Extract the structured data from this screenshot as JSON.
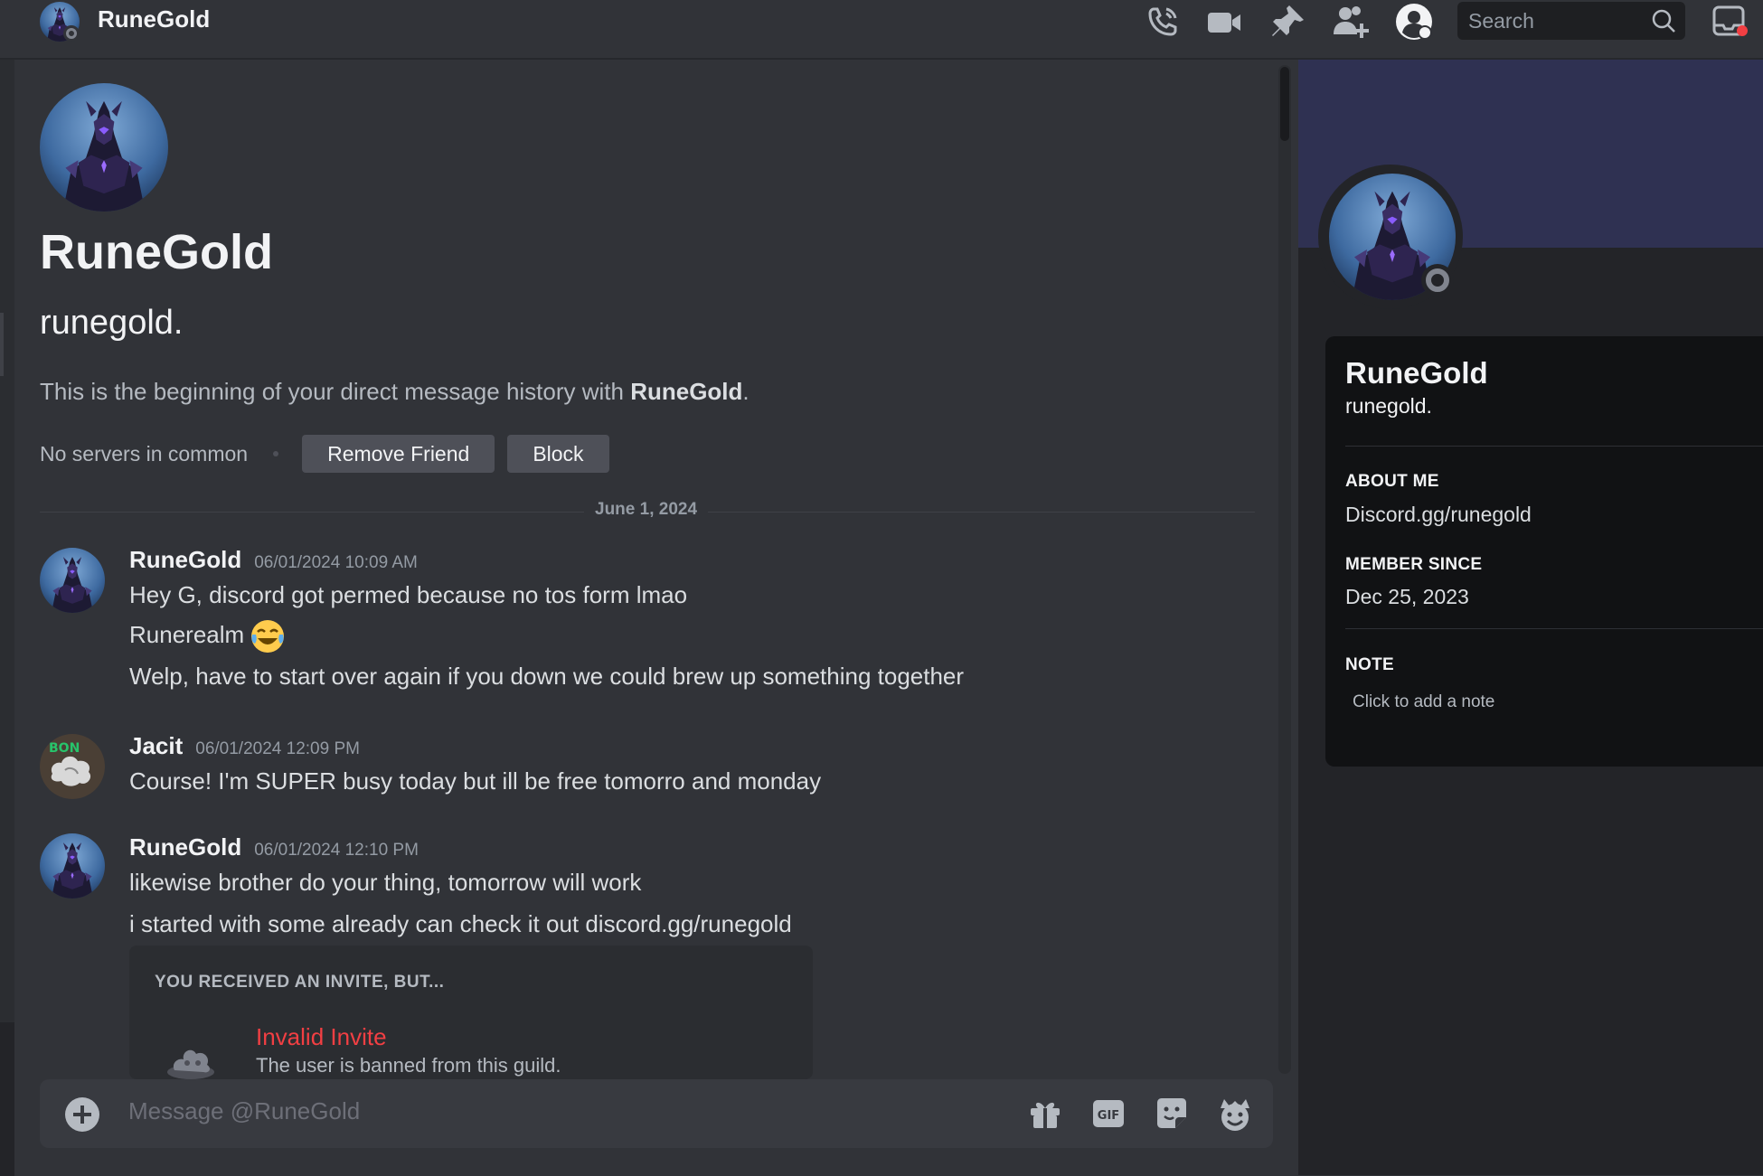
{
  "header": {
    "title": "RuneGold",
    "search_placeholder": "Search",
    "icons": [
      "voice-call-icon",
      "video-call-icon",
      "pinned-messages-icon",
      "add-friends-icon",
      "user-profile-icon",
      "search-icon",
      "inbox-icon"
    ]
  },
  "intro": {
    "display_name": "RuneGold",
    "username": "runegold.",
    "beginning_prefix": "This is the beginning of your direct message history with ",
    "beginning_name": "RuneGold",
    "beginning_suffix": ".",
    "mutual_servers": "No servers in common",
    "remove_friend_label": "Remove Friend",
    "block_label": "Block"
  },
  "date_divider": "June 1, 2024",
  "messages": [
    {
      "author": "RuneGold",
      "timestamp": "06/01/2024 10:09 AM",
      "lines": [
        "Hey G, discord got permed because no tos form lmao",
        "Runerealm",
        "Welp, have to start over again if you down we could brew up something together"
      ],
      "emoji": "joy-emoji"
    },
    {
      "author": "Jacit",
      "timestamp": "06/01/2024 12:09 PM",
      "lines": [
        "Course! I'm SUPER busy today but ill be free tomorro and monday"
      ]
    },
    {
      "author": "RuneGold",
      "timestamp": "06/01/2024 12:10 PM",
      "lines": [
        "likewise brother do your thing, tomorrow will work",
        "i started with some already can check it out discord.gg/runegold"
      ]
    }
  ],
  "invite": {
    "title": "YOU RECEIVED AN INVITE, BUT...",
    "name": "Invalid Invite",
    "description": "The user is banned from this guild."
  },
  "composer": {
    "placeholder": "Message @RuneGold",
    "icons": [
      "add-attachment-icon",
      "gift-icon",
      "gif-icon",
      "sticker-icon",
      "emoji-icon"
    ]
  },
  "profile": {
    "display_name": "RuneGold",
    "username": "runegold.",
    "about_label": "ABOUT ME",
    "about_value": "Discord.gg/runegold",
    "member_since_label": "MEMBER SINCE",
    "member_since_value": "Dec 25, 2023",
    "note_label": "NOTE",
    "note_placeholder": "Click to add a note"
  },
  "colors": {
    "background": "#313338",
    "panel": "#232428",
    "card": "#111214",
    "banner": "#2f3152",
    "danger": "#f23f43",
    "offline_status": "#80848e"
  }
}
